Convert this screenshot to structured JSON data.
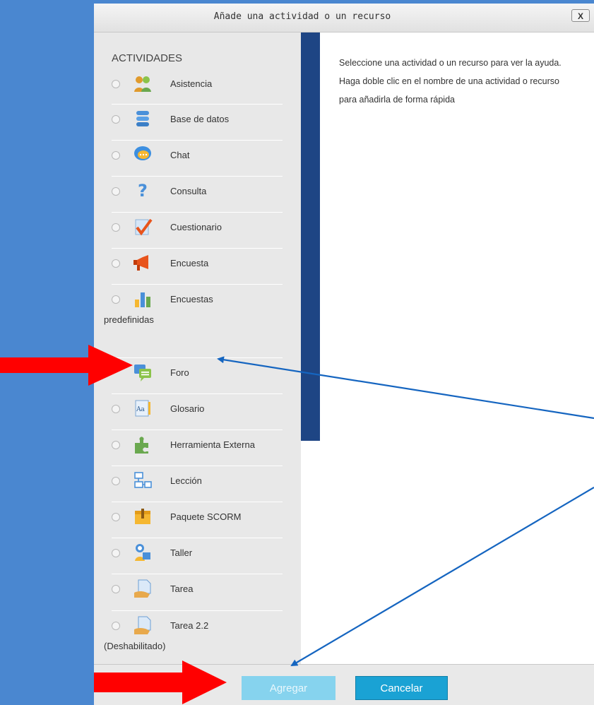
{
  "dialog": {
    "title": "Añade una actividad o un recurso",
    "close_label": "X"
  },
  "activities": {
    "heading": "ACTIVIDADES",
    "items": [
      {
        "label": "Asistencia",
        "icon": "attendance-icon"
      },
      {
        "label": "Base de datos",
        "icon": "database-icon"
      },
      {
        "label": "Chat",
        "icon": "chat-icon"
      },
      {
        "label": "Consulta",
        "icon": "question-icon"
      },
      {
        "label": "Cuestionario",
        "icon": "quiz-icon"
      },
      {
        "label": "Encuesta",
        "icon": "megaphone-icon"
      },
      {
        "label": "Encuestas",
        "label2": "predefinidas",
        "icon": "bar-chart-icon"
      },
      {
        "label": "Foro",
        "icon": "forum-icon"
      },
      {
        "label": "Glosario",
        "icon": "glossary-icon"
      },
      {
        "label": "Herramienta Externa",
        "icon": "puzzle-icon"
      },
      {
        "label": "Lección",
        "icon": "lesson-icon"
      },
      {
        "label": "Paquete SCORM",
        "icon": "package-icon"
      },
      {
        "label": "Taller",
        "icon": "workshop-icon"
      },
      {
        "label": "Tarea",
        "icon": "assignment-icon"
      },
      {
        "label": "Tarea 2.2",
        "label2": "(Deshabilitado)",
        "icon": "assignment-icon"
      }
    ]
  },
  "help": {
    "text": "Seleccione una actividad o un recurso para ver la ayuda. Haga doble clic en el nombre de una actividad o recurso para añadirla de forma rápida"
  },
  "footer": {
    "add_label": "Agregar",
    "cancel_label": "Cancelar"
  },
  "colors": {
    "background": "#4a87d0",
    "scrollbar": "#1e4584",
    "arrow_red": "#ff0000",
    "arrow_blue": "#1565c0",
    "add_button": "#86d3ee",
    "cancel_button": "#1aa2d4"
  }
}
